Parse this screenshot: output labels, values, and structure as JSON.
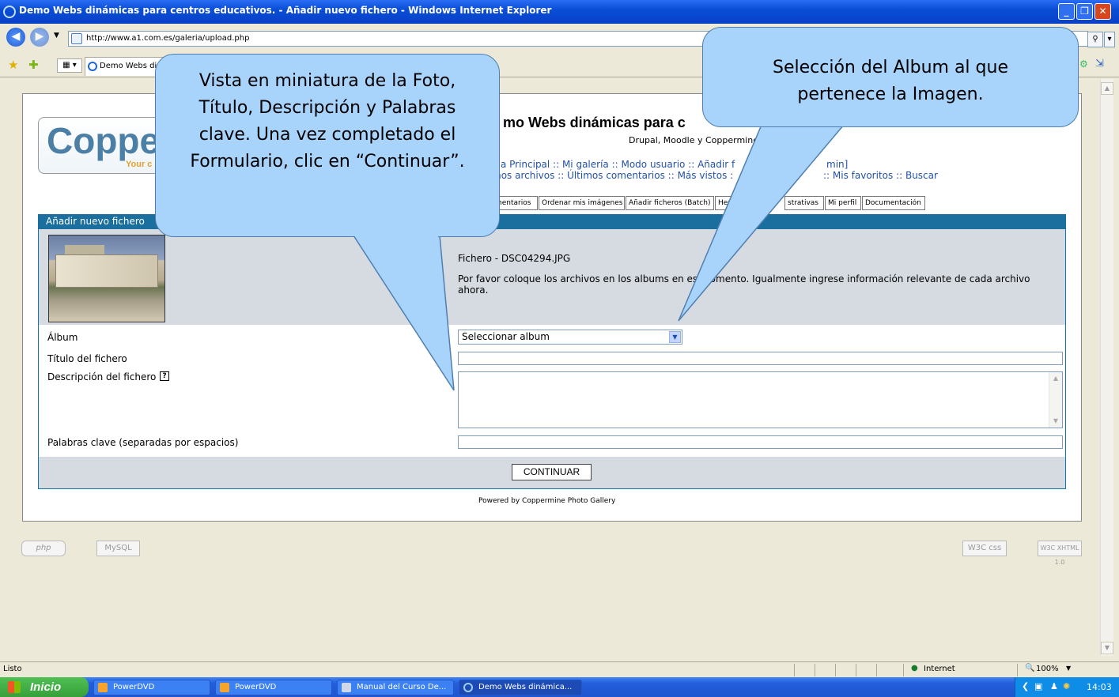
{
  "window": {
    "title": "Demo Webs dinámicas para centros educativos. - Añadir nuevo fichero - Windows Internet Explorer",
    "url": "http://www.a1.com.es/galeria/upload.php",
    "tab_label": "Demo Webs diná"
  },
  "site": {
    "logo_text": "Coppe",
    "logo_sub": "Your c",
    "title": "mo Webs dinámicas para c",
    "subtitle": "Drupal, Moodle y Coppermine",
    "nav_line1": "ina Principal :: Mi galería :: Modo usuario :: Añadir f",
    "nav_line1_end": "min]",
    "nav_line2": "mos archivos :: Últimos comentarios :: Más vistos :",
    "nav_line2_end": ":: Mis favoritos :: Buscar",
    "menu_tabs": [
      "mentarios",
      "Ordenar mis imágenes",
      "Añadir ficheros (Batch)",
      "Herr",
      "strativas",
      "Mi perfil",
      "Documentación"
    ]
  },
  "form": {
    "header": "Añadir nuevo fichero",
    "file_info": "Fichero - DSC04294.JPG",
    "note": "Por favor coloque los archivos en los albums en es    momento. Igualmente ingrese información relevante de cada archivo ahora.",
    "album_label": "Álbum",
    "album_value": "Seleccionar album",
    "title_label": "Título del fichero",
    "desc_label": "Descripción del fichero",
    "help_glyph": "?",
    "keywords_label": "Palabras clave (separadas por espacios)",
    "submit": "CONTINUAR",
    "powered": "Powered by Coppermine Photo Gallery"
  },
  "badges": {
    "php": "php",
    "mysql": "MySQL",
    "css": "W3C css",
    "xhtml": "W3C XHTML 1.0"
  },
  "callouts": {
    "left": "Vista en miniatura de la Foto, Título, Descripción y Palabras clave. Una vez completado el Formulario, clic en “Continuar”.",
    "right": "Selección del Album al que pertenece la Imagen."
  },
  "statusbar": {
    "left": "Listo",
    "zone": "Internet",
    "zoom": "100%"
  },
  "taskbar": {
    "start": "Inicio",
    "tasks": [
      "PowerDVD",
      "PowerDVD",
      "Manual del Curso De...",
      "Demo Webs dinámica..."
    ],
    "clock": "14:03"
  },
  "colors": {
    "callout_fill": "#a8d3fb",
    "form_header": "#1a6f9e",
    "link": "#2251a8"
  }
}
